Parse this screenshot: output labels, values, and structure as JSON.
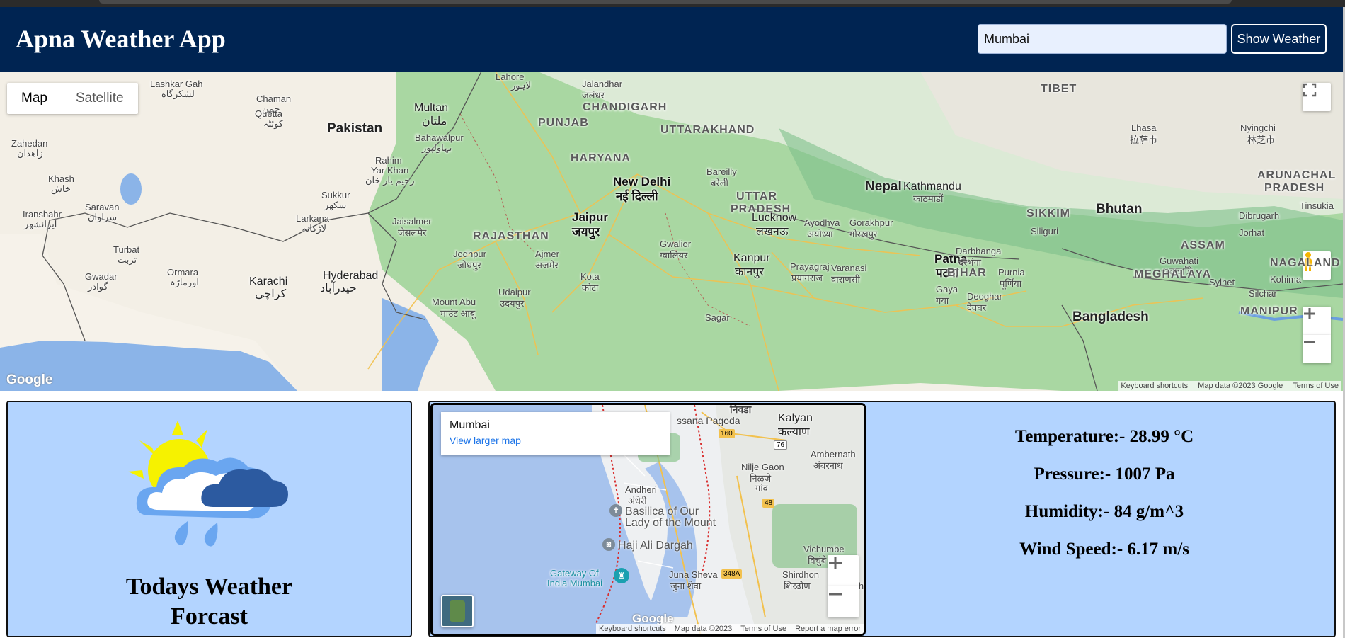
{
  "app": {
    "title": "Apna Weather App"
  },
  "search": {
    "value": "Mumbai",
    "button_label": "Show Weather"
  },
  "big_map": {
    "map_type_options": [
      "Map",
      "Satellite"
    ],
    "active_map_type": "Map",
    "attribution": [
      "Keyboard shortcuts",
      "Map data ©2023 Google",
      "Terms of Use"
    ],
    "logo_text": "Google",
    "labels": {
      "lashkar_gah": "Lashkar Gah",
      "lashkar_gah_local": "لشکرگاه",
      "chaman": "Chaman",
      "chaman_local": "چمن",
      "quetta": "Quetta",
      "quetta_local": "کوئٹہ",
      "lahore": "Lahore",
      "lahore_local": "لاہور",
      "jalandhar": "Jalandhar",
      "jalandhar_local": "जलंधर",
      "tibet": "TIBET",
      "multan": "Multan",
      "multan_local": "ملتان",
      "chandigarh": "CHANDIGARH",
      "punjab": "PUNJAB",
      "uttarakhand": "UTTARAKHAND",
      "pakistan": "Pakistan",
      "lhasa": "Lhasa",
      "lhasa_local": "拉萨市",
      "nyingchi": "Nyingchi",
      "nyingchi_local": "林芝市",
      "zahedan": "Zahedan",
      "zahedan_local": "زاهدان",
      "bahawalpur": "Bahawalpur",
      "bahawalpur_local": "بہاولپور",
      "haryana": "HARYANA",
      "rahim_yar_khan": "Rahim",
      "rahim_yar_khan_2": "Yar Khan",
      "rahim_yar_khan_local": "رحیم یار خان",
      "new_delhi": "New Delhi",
      "new_delhi_local": "नई दिल्ली",
      "bareilly": "Bareilly",
      "bareilly_local": "बरेली",
      "khash": "Khash",
      "khash_local": "خاش",
      "nepal": "Nepal",
      "kathmandu": "Kathmandu",
      "kathmandu_local": "काठमाडौं",
      "arunachal": "ARUNACHAL",
      "pradesh": "PRADESH",
      "sukkur": "Sukkur",
      "sukkur_local": "سکھر",
      "saravan": "Saravan",
      "saravan_local": "سراوان",
      "uttar": "UTTAR",
      "uttar_pradesh": "PRADESH",
      "iranshahr": "Iranshahr",
      "iranshahr_local": "ایرانشهر",
      "larkana": "Larkana",
      "larkana_local": "لاڑکانہ",
      "jaisalmer": "Jaisalmer",
      "jaisalmer_local": "जैसलमेर",
      "jaipur": "Jaipur",
      "jaipur_local": "जयपुर",
      "lucknow": "Lucknow",
      "lucknow_local": "लखनऊ",
      "ayodhya": "Ayodhya",
      "ayodhya_local": "अयोध्या",
      "gorakhpur": "Gorakhpur",
      "gorakhpur_local": "गोरखपुर",
      "sikkim": "SIKKIM",
      "bhutan": "Bhutan",
      "tinsukia": "Tinsukia",
      "dibrugarh": "Dibrugarh",
      "siliguri": "Siliguri",
      "jorhat": "Jorhat",
      "rajasthan": "RAJASTHAN",
      "gwalior": "Gwalior",
      "gwalior_local": "ग्वालियर",
      "assam": "ASSAM",
      "turbat": "Turbat",
      "turbat_local": "تربت",
      "jodhpur": "Jodhpur",
      "jodhpur_local": "जोधपुर",
      "ajmer": "Ajmer",
      "ajmer_local": "अजमेर",
      "kanpur": "Kanpur",
      "kanpur_local": "कानपुर",
      "patna": "Patna",
      "patna_local": "पटना",
      "darbhanga": "Darbhanga",
      "darbhanga_local": "दरभंगा",
      "guwahati": "Guwahati",
      "guwahati_local": "গুৱাহাটী",
      "nagaland": "NAGALAND",
      "prayagraj": "Prayagraj",
      "prayagraj_local": "प्रयागराज",
      "varanasi": "Varanasi",
      "varanasi_local": "वाराणसी",
      "bihar": "BIHAR",
      "meghalaya": "MEGHALAYA",
      "purnia": "Purnia",
      "purnia_local": "पूर्णिया",
      "kohima": "Kohima",
      "gwadar": "Gwadar",
      "gwadar_local": "گوادر",
      "ormara": "Ormara",
      "ormara_local": "اورماڑہ",
      "karachi": "Karachi",
      "karachi_local": "کراچی",
      "hyderabad": "Hyderabad",
      "hyderabad_local": "حیدرآباد",
      "kota": "Kota",
      "kota_local": "कोटा",
      "gaya": "Gaya",
      "gaya_local": "गया",
      "sylhet": "Sylhet",
      "silchar": "Silchar",
      "mount_abu": "Mount Abu",
      "mount_abu_local": "माउंट आबू",
      "udaipur": "Udaipur",
      "udaipur_local": "उदयपुर",
      "deoghar": "Deoghar",
      "deoghar_local": "देवघर",
      "manipur": "MANIPUR",
      "sagar": "Sagar",
      "bangladesh": "Bangladesh"
    }
  },
  "forecast": {
    "title_line1": "Todays Weather",
    "title_line2": "Forcast"
  },
  "small_map": {
    "info_city": "Mumbai",
    "info_link": "View larger map",
    "attribution": [
      "Keyboard shortcuts",
      "Map data ©2023",
      "Terms of Use",
      "Report a map error"
    ],
    "logo_text": "Google",
    "labels": {
      "nashik_partial": "निवडा",
      "vassana_pagoda": "ssana Pagoda",
      "kalyan": "Kalyan",
      "kalyan_local": "कल्याण",
      "road_160": "160",
      "road_76": "76",
      "road_48": "48",
      "road_348a": "348A",
      "ambernath": "Ambernath",
      "ambernath_local": "अंबरनाथ",
      "nilje_gaon": "Nilje Gaon",
      "nilje_gaon_local": "निळजे",
      "nilje_gaon_local_2": "गांव",
      "andheri": "Andheri",
      "andheri_local": "अंधेरी",
      "basilica": "Basilica of Our",
      "basilica_2": "Lady of the Mount",
      "haji_ali": "Haji Ali Dargah",
      "vichumbe": "Vichumbe",
      "vichumbe_local": "विचुंबे",
      "gateway": "Gateway Of",
      "gateway_2": "India Mumbai",
      "juna_sheva": "Juna Sheva",
      "juna_sheva_local": "जुना शेवा",
      "shirdhon": "Shirdhon",
      "shirdhon_local": "शिरढोण",
      "nadha": "Nadha"
    }
  },
  "weather": {
    "temperature": "Temperature:- 28.99 °C",
    "pressure": "Pressure:- 1007 Pa",
    "humidity": "Humidity:- 84 g/m^3",
    "wind_speed": "Wind Speed:- 6.17 m/s"
  },
  "colors": {
    "header_bg": "#002452",
    "panel_bg": "#b3d4ff",
    "input_bg": "#e8f0fe",
    "link": "#1a73e8"
  }
}
